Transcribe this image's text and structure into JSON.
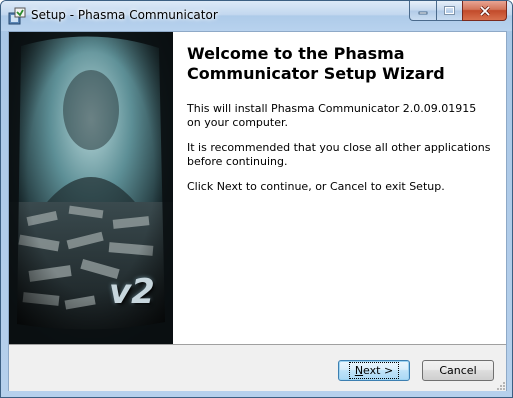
{
  "window": {
    "title": "Setup - Phasma Communicator",
    "app_icon": "setup-installer-icon",
    "caption_buttons": {
      "minimize": "minimize-icon",
      "maximize": "maximize-icon",
      "close": "close-icon"
    }
  },
  "side_image": {
    "badge_text": "v2",
    "description_icon": "phasma-banner-image"
  },
  "welcome": {
    "title": "Welcome to the Phasma Communicator Setup Wizard",
    "paragraph1": "This will install Phasma Communicator 2.0.09.01915 on your computer.",
    "paragraph2": "It is recommended that you close all other applications before continuing.",
    "paragraph3": "Click Next to continue, or Cancel to exit Setup."
  },
  "buttons": {
    "next_accel": "N",
    "next_rest": "ext >",
    "cancel": "Cancel"
  },
  "colors": {
    "titlebar": "#c3d8ef",
    "close_button": "#c24a2a",
    "default_button_border": "#3c7fb1",
    "bottom_panel": "#f0f0f0"
  }
}
